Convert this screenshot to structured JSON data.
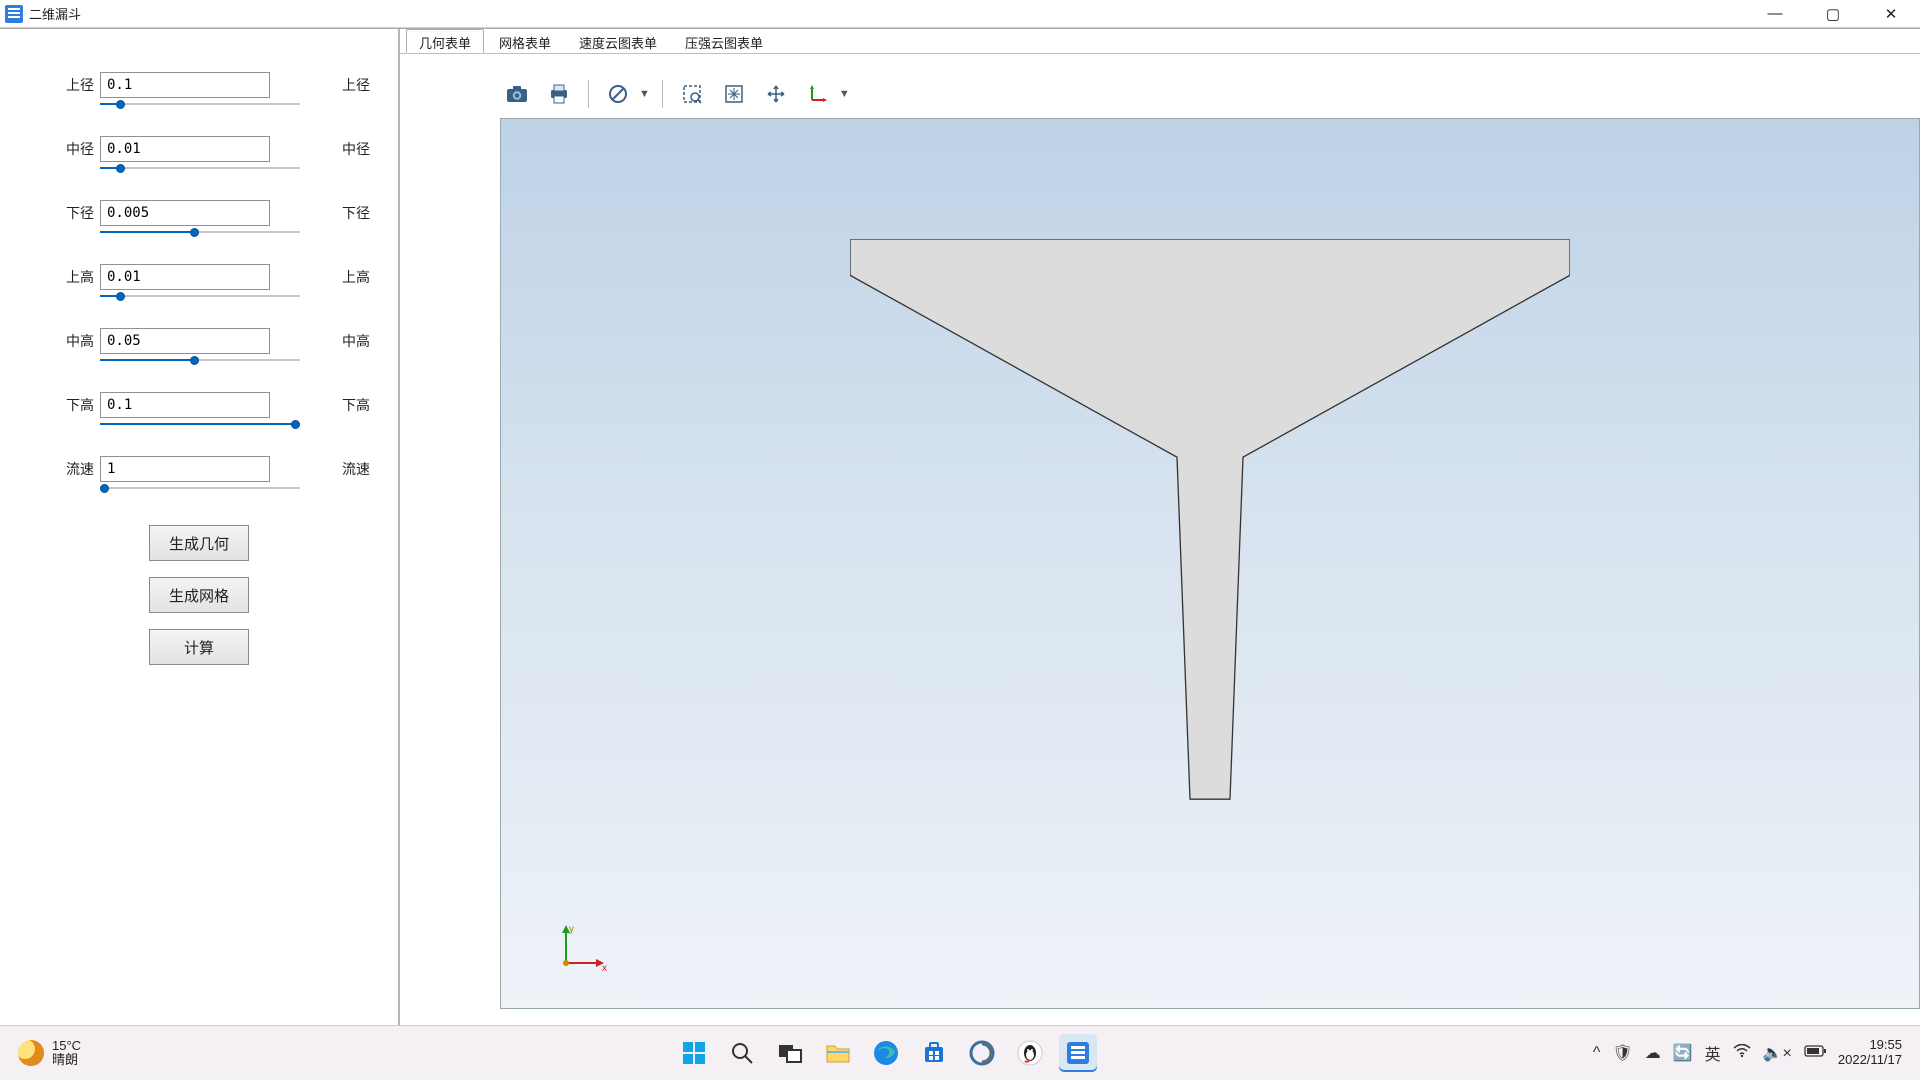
{
  "window": {
    "title": "二维漏斗"
  },
  "params": {
    "top_radius": {
      "label_l": "上径",
      "label_r": "上径",
      "value": "0.1",
      "fill": 8
    },
    "mid_radius": {
      "label_l": "中径",
      "label_r": "中径",
      "value": "0.01",
      "fill": 8
    },
    "bot_radius": {
      "label_l": "下径",
      "label_r": "下径",
      "value": "0.005",
      "fill": 45
    },
    "top_height": {
      "label_l": "上高",
      "label_r": "上高",
      "value": "0.01",
      "fill": 8
    },
    "mid_height": {
      "label_l": "中高",
      "label_r": "中高",
      "value": "0.05",
      "fill": 45
    },
    "bot_height": {
      "label_l": "下高",
      "label_r": "下高",
      "value": "0.1",
      "fill": 100
    },
    "flow_speed": {
      "label_l": "流速",
      "label_r": "流速",
      "value": "1",
      "fill": 0
    }
  },
  "buttons": {
    "gen_geom": "生成几何",
    "gen_mesh": "生成网格",
    "compute": "计算"
  },
  "menus": {
    "geom": "几何表单",
    "mesh": "网格表单",
    "velocity": "速度云图表单",
    "pressure": "压强云图表单"
  },
  "toolbar_icons": {
    "camera": "camera-icon",
    "print": "print-icon",
    "clear": "clear-icon",
    "box_select": "box-select-icon",
    "fit": "fit-icon",
    "reset": "reset-view-icon",
    "axis": "axis-menu-icon"
  },
  "axis_labels": {
    "x": "x",
    "y": "y"
  },
  "taskbar": {
    "weather_temp": "15°C",
    "weather_desc": "晴朗",
    "ime": "英",
    "time": "19:55",
    "date": "2022/11/17"
  }
}
